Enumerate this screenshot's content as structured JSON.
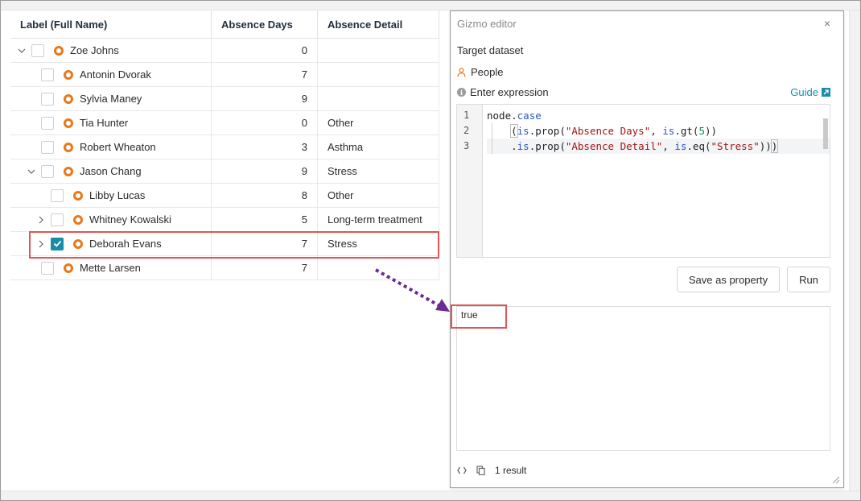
{
  "table": {
    "headers": {
      "label": "Label (Full Name)",
      "days": "Absence Days",
      "detail": "Absence Detail"
    },
    "rows": [
      {
        "name": "Zoe Johns",
        "days": "0",
        "detail": ""
      },
      {
        "name": "Antonin Dvorak",
        "days": "7",
        "detail": ""
      },
      {
        "name": "Sylvia Maney",
        "days": "9",
        "detail": ""
      },
      {
        "name": "Tia Hunter",
        "days": "0",
        "detail": "Other"
      },
      {
        "name": "Robert Wheaton",
        "days": "3",
        "detail": "Asthma"
      },
      {
        "name": "Jason Chang",
        "days": "9",
        "detail": "Stress"
      },
      {
        "name": "Libby Lucas",
        "days": "8",
        "detail": "Other"
      },
      {
        "name": "Whitney Kowalski",
        "days": "5",
        "detail": "Long-term treatment"
      },
      {
        "name": "Deborah Evans",
        "days": "7",
        "detail": "Stress"
      },
      {
        "name": "Mette Larsen",
        "days": "7",
        "detail": ""
      }
    ]
  },
  "editor": {
    "title": "Gizmo editor",
    "target_label": "Target dataset",
    "dataset": "People",
    "expression_label": "Enter expression",
    "guide_label": "Guide",
    "line_numbers": [
      "1",
      "2",
      "3"
    ],
    "code": {
      "l1_a": "node.",
      "l1_kw": "case",
      "l2_indent": "    ",
      "l2_open": "(",
      "l2_kw1": "is",
      "l2_a": ".prop(",
      "l2_str": "\"Absence Days\"",
      "l2_b": ", ",
      "l2_kw2": "is",
      "l2_c": ".gt(",
      "l2_num": "5",
      "l2_d": "))",
      "l3_indent": "    .",
      "l3_kw1": "is",
      "l3_a": ".prop(",
      "l3_str1": "\"Absence Detail\"",
      "l3_b": ", ",
      "l3_kw2": "is",
      "l3_c": ".eq(",
      "l3_str2": "\"Stress\"",
      "l3_d": "))",
      "l3_close": ")"
    },
    "save_label": "Save as property",
    "run_label": "Run",
    "result_value": "true",
    "result_count": "1 result"
  },
  "colors": {
    "node_icon": "#e9781b",
    "accent": "#1a8ca8",
    "highlight": "#e05555",
    "arrow": "#6a2c91"
  }
}
